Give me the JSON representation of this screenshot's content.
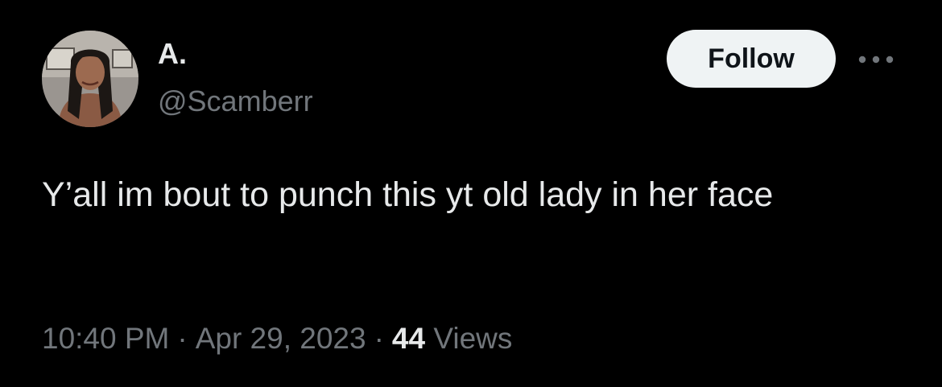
{
  "author": {
    "display_name": "A.",
    "handle": "@Scamberr",
    "avatar_icon": "profile-photo"
  },
  "follow_button": {
    "label": "Follow"
  },
  "more_button": {
    "icon": "more-horizontal-icon"
  },
  "tweet": {
    "text": "Y’all im bout to punch this yt old lady in her face"
  },
  "meta": {
    "time": "10:40 PM",
    "separator": "·",
    "date": "Apr 29, 2023",
    "views_count": "44",
    "views_label": "Views"
  },
  "colors": {
    "background": "#000000",
    "primary_text": "#e7e9ea",
    "secondary_text": "#71767b",
    "follow_button_bg": "#eff3f4",
    "follow_button_text": "#0f1419"
  }
}
